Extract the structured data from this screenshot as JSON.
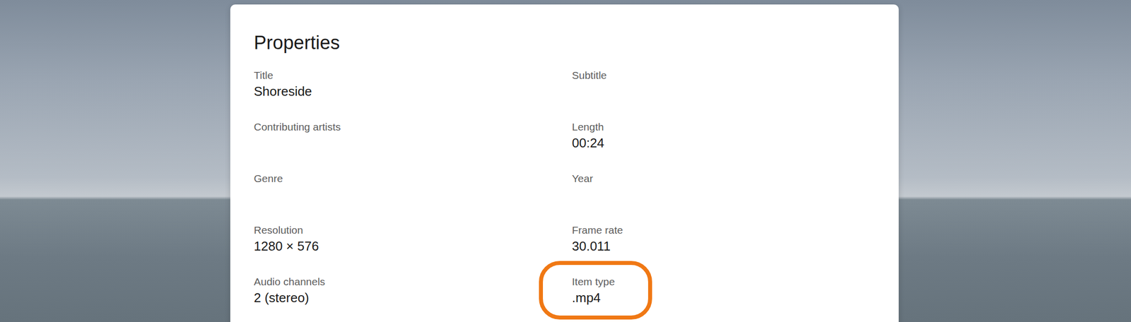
{
  "dialog": {
    "title": "Properties",
    "fields": [
      {
        "label": "Title",
        "value": "Shoreside",
        "highlighted": false
      },
      {
        "label": "Subtitle",
        "highlighted": false
      },
      {
        "label": "Contributing artists",
        "highlighted": false
      },
      {
        "label": "Length",
        "value": "00:24",
        "highlighted": false
      },
      {
        "label": "Genre",
        "highlighted": false
      },
      {
        "label": "Year",
        "highlighted": false
      },
      {
        "label": "Resolution",
        "value": "1280 × 576",
        "highlighted": false
      },
      {
        "label": "Frame rate",
        "value": "30.011",
        "highlighted": false
      },
      {
        "label": "Audio channels",
        "value": "2 (stereo)",
        "highlighted": false
      },
      {
        "label": "Item type",
        "value": ".mp4",
        "highlighted": true
      }
    ]
  }
}
